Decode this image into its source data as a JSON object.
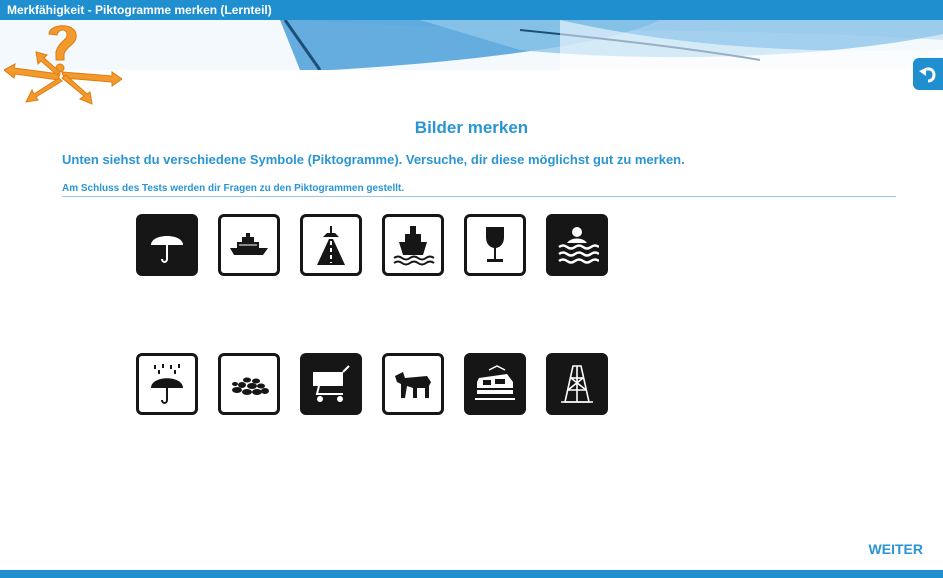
{
  "window": {
    "title": "Merkfähigkeit - Piktogramme merken (Lernteil)"
  },
  "colors": {
    "accent": "#2a95d3",
    "titlebar": "#1f8fcf",
    "pictogram": "#161616"
  },
  "main": {
    "heading": "Bilder merken",
    "intro": "Unten siehst du verschiedene Symbole (Piktogramme). Versuche, dir diese möglichst gut zu merken.",
    "note": "Am Schluss des Tests werden dir Fragen zu den Piktogrammen gestellt."
  },
  "pictograms": {
    "row1": [
      {
        "icon": "umbrella-icon",
        "style": "dark"
      },
      {
        "icon": "cruise-ship-icon",
        "style": "light"
      },
      {
        "icon": "road-lamp-icon",
        "style": "light"
      },
      {
        "icon": "ship-bow-waves-icon",
        "style": "light"
      },
      {
        "icon": "wine-glass-icon",
        "style": "light"
      },
      {
        "icon": "swimmer-waves-icon",
        "style": "dark"
      }
    ],
    "row2": [
      {
        "icon": "umbrella-rain-icon",
        "style": "light"
      },
      {
        "icon": "stone-pile-icon",
        "style": "light"
      },
      {
        "icon": "shopping-cart-icon",
        "style": "dark"
      },
      {
        "icon": "animal-icon",
        "style": "light"
      },
      {
        "icon": "tram-icon",
        "style": "dark"
      },
      {
        "icon": "tower-icon",
        "style": "dark"
      }
    ]
  },
  "footer": {
    "next_label": "WEITER"
  },
  "icons": {
    "logo": "question-arrows-logo",
    "back": "back-arrow-icon"
  }
}
